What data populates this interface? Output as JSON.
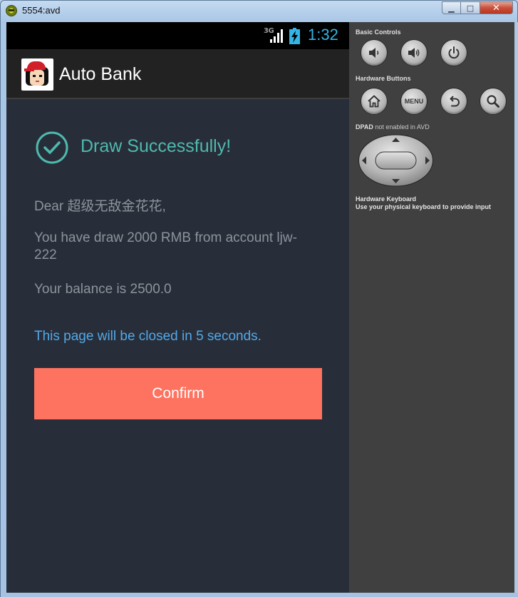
{
  "window": {
    "title": "5554:avd",
    "minimize_glyph": "▁",
    "maximize_glyph": "□",
    "close_glyph": "✕"
  },
  "statusbar": {
    "network": "3G",
    "time": "1:32",
    "clock_color": "#33b5e5"
  },
  "actionbar": {
    "title": "Auto Bank"
  },
  "result": {
    "title": "Draw Successfully!",
    "greeting": "Dear 超级无敌金花花,",
    "message": "You have draw 2000 RMB from account ljw-222",
    "balance": "Your balance is 2500.0",
    "countdown": "This page will be closed in 5 seconds.",
    "confirm_label": "Confirm",
    "accent_color": "#4fb9ae",
    "button_color": "#fe7260"
  },
  "controls": {
    "basic_label": "Basic Controls",
    "hardware_label": "Hardware Buttons",
    "menu_label": "MENU",
    "dpad_label": "DPAD",
    "dpad_note": "not enabled in AVD",
    "keyboard_label": "Hardware Keyboard",
    "keyboard_note": "Use your physical keyboard to provide input"
  }
}
